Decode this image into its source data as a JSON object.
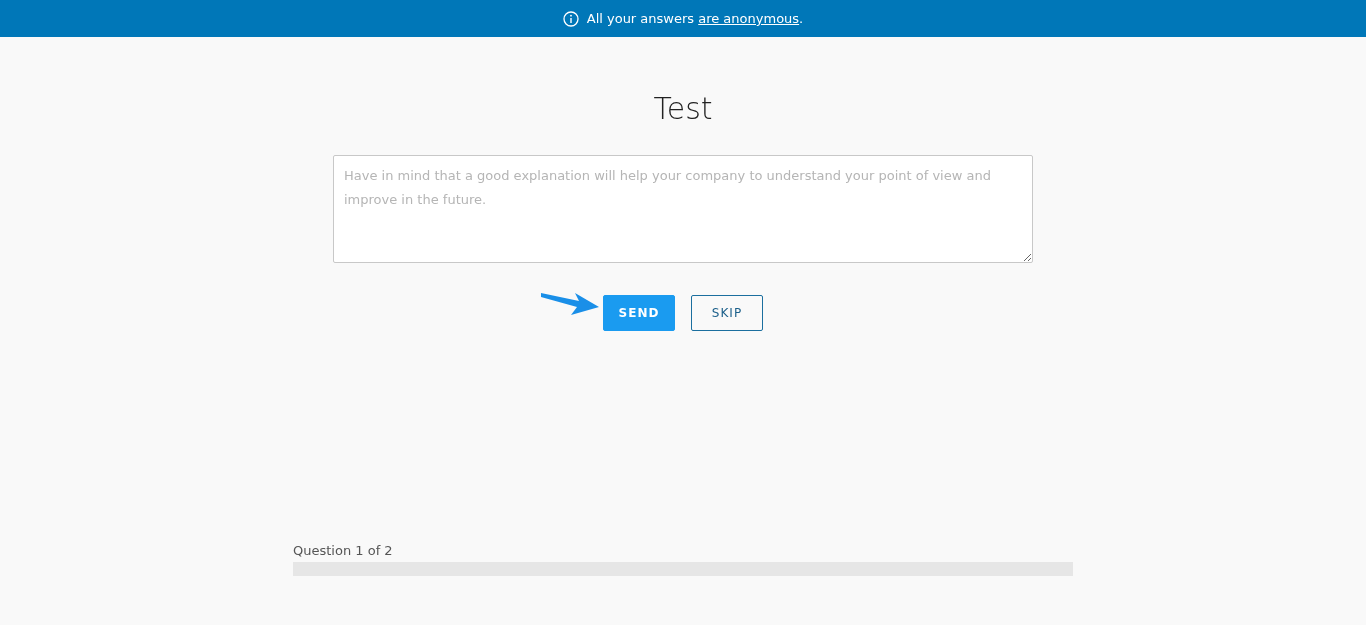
{
  "notice": {
    "text": "All your answers ",
    "link": "are anonymous",
    "after": "."
  },
  "title": "Test",
  "answer": {
    "placeholder": "Have in mind that a good explanation will help your company to understand your point of view and improve in the future."
  },
  "buttons": [
    {
      "label": "SEND",
      "kind": "primary"
    },
    {
      "label": "SKIP",
      "kind": "secondary"
    }
  ],
  "progress": {
    "label": "Question 1 of 2",
    "level": 0
  }
}
